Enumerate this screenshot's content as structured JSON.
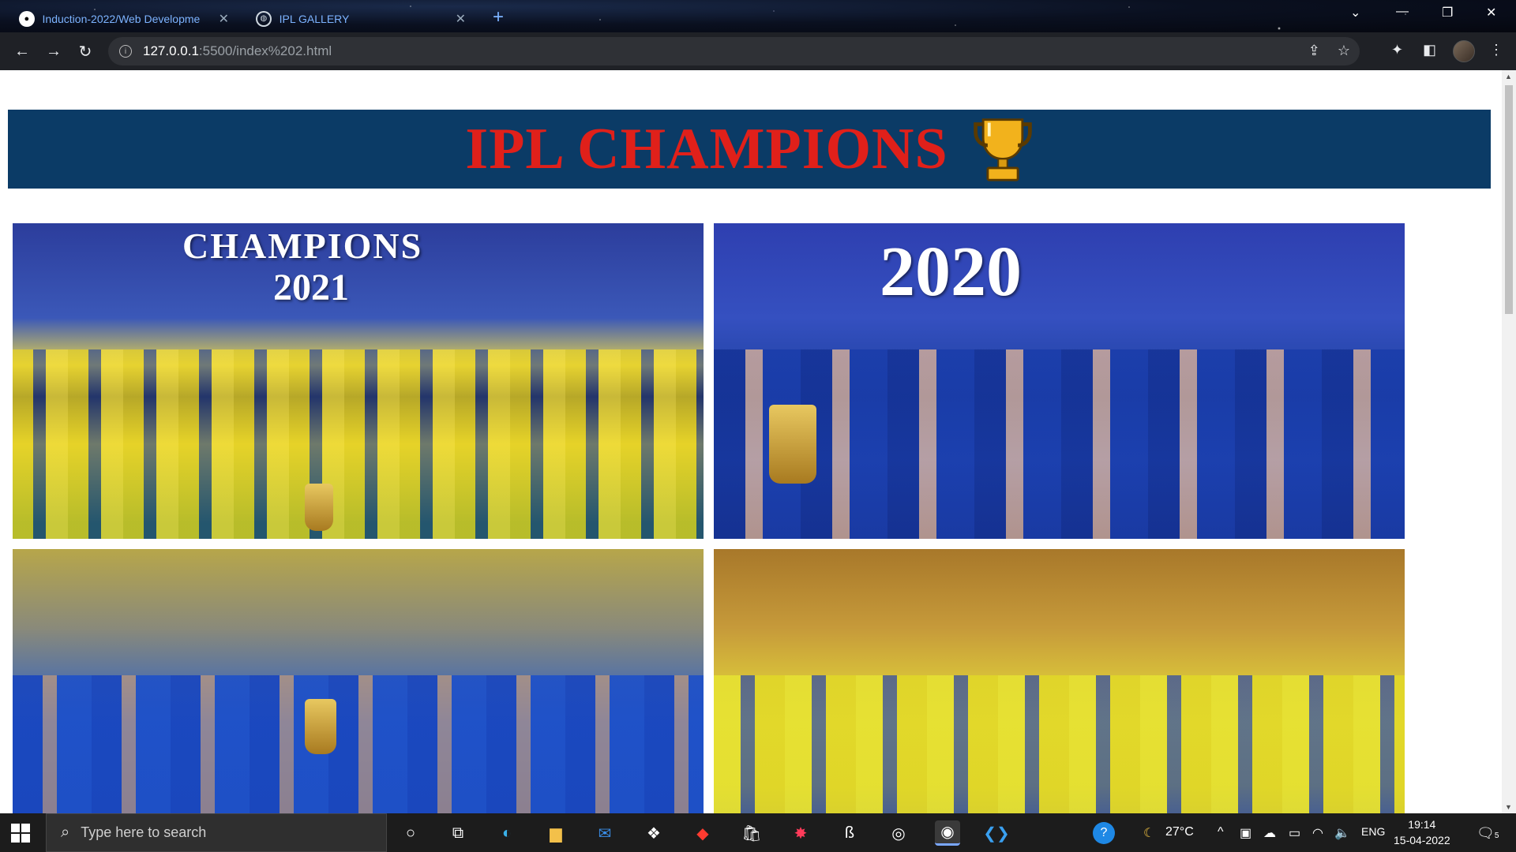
{
  "browser": {
    "tabs": [
      {
        "title": "Induction-2022/Web Developme",
        "icon": "github-icon"
      },
      {
        "title": "IPL GALLERY",
        "icon": "globe-icon"
      }
    ],
    "url_host": "127.0.0.1",
    "url_rest": ":5500/index%202.html"
  },
  "page": {
    "heading": "IPL CHAMPIONS",
    "trophy_icon": "trophy-icon",
    "banner_color": "#0b3b66",
    "heading_color": "#e0201a",
    "photos": [
      {
        "overlay_title": "CHAMPIONS",
        "overlay_year": "2021",
        "name": "champions-2021-photo"
      },
      {
        "overlay_title": "",
        "overlay_year": "2020",
        "name": "champions-2020-photo"
      },
      {
        "overlay_title": "",
        "overlay_year": "",
        "name": "mumbai-celebration-photo"
      },
      {
        "overlay_title": "",
        "overlay_year": "",
        "name": "chennai-celebration-photo"
      }
    ]
  },
  "taskbar": {
    "search_placeholder": "Type here to search",
    "weather": "27°C",
    "language": "ENG",
    "time": "19:14",
    "date": "15-04-2022",
    "notification_count": "5"
  }
}
